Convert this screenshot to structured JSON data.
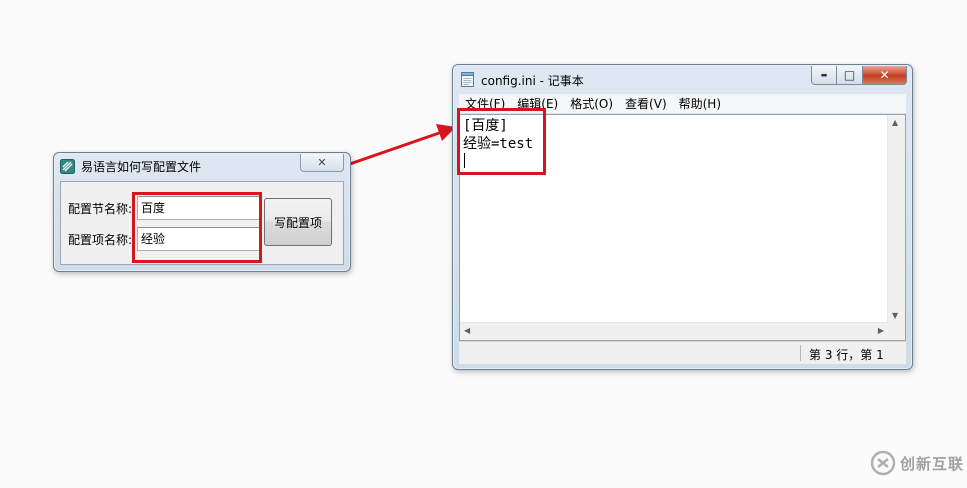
{
  "dialog": {
    "title": "易语言如何写配置文件",
    "close_glyph": "✕",
    "section_label": "配置节名称:",
    "section_value": "百度",
    "item_label": "配置项名称:",
    "item_value": "经验",
    "write_button": "写配置项",
    "icon": "app-icon"
  },
  "notepad": {
    "title": "config.ini - 记事本",
    "icon": "notepad-icon",
    "minimize_glyph": "▬",
    "maximize_glyph": "□",
    "close_glyph": "✕",
    "menu": [
      "文件(F)",
      "编辑(E)",
      "格式(O)",
      "查看(V)",
      "帮助(H)"
    ],
    "content_line1": "[百度]",
    "content_line2": "经验=test",
    "status": "第 3 行，第 1"
  },
  "annotation": {
    "color": "#d9141d"
  },
  "watermark": {
    "text": "创新互联"
  }
}
